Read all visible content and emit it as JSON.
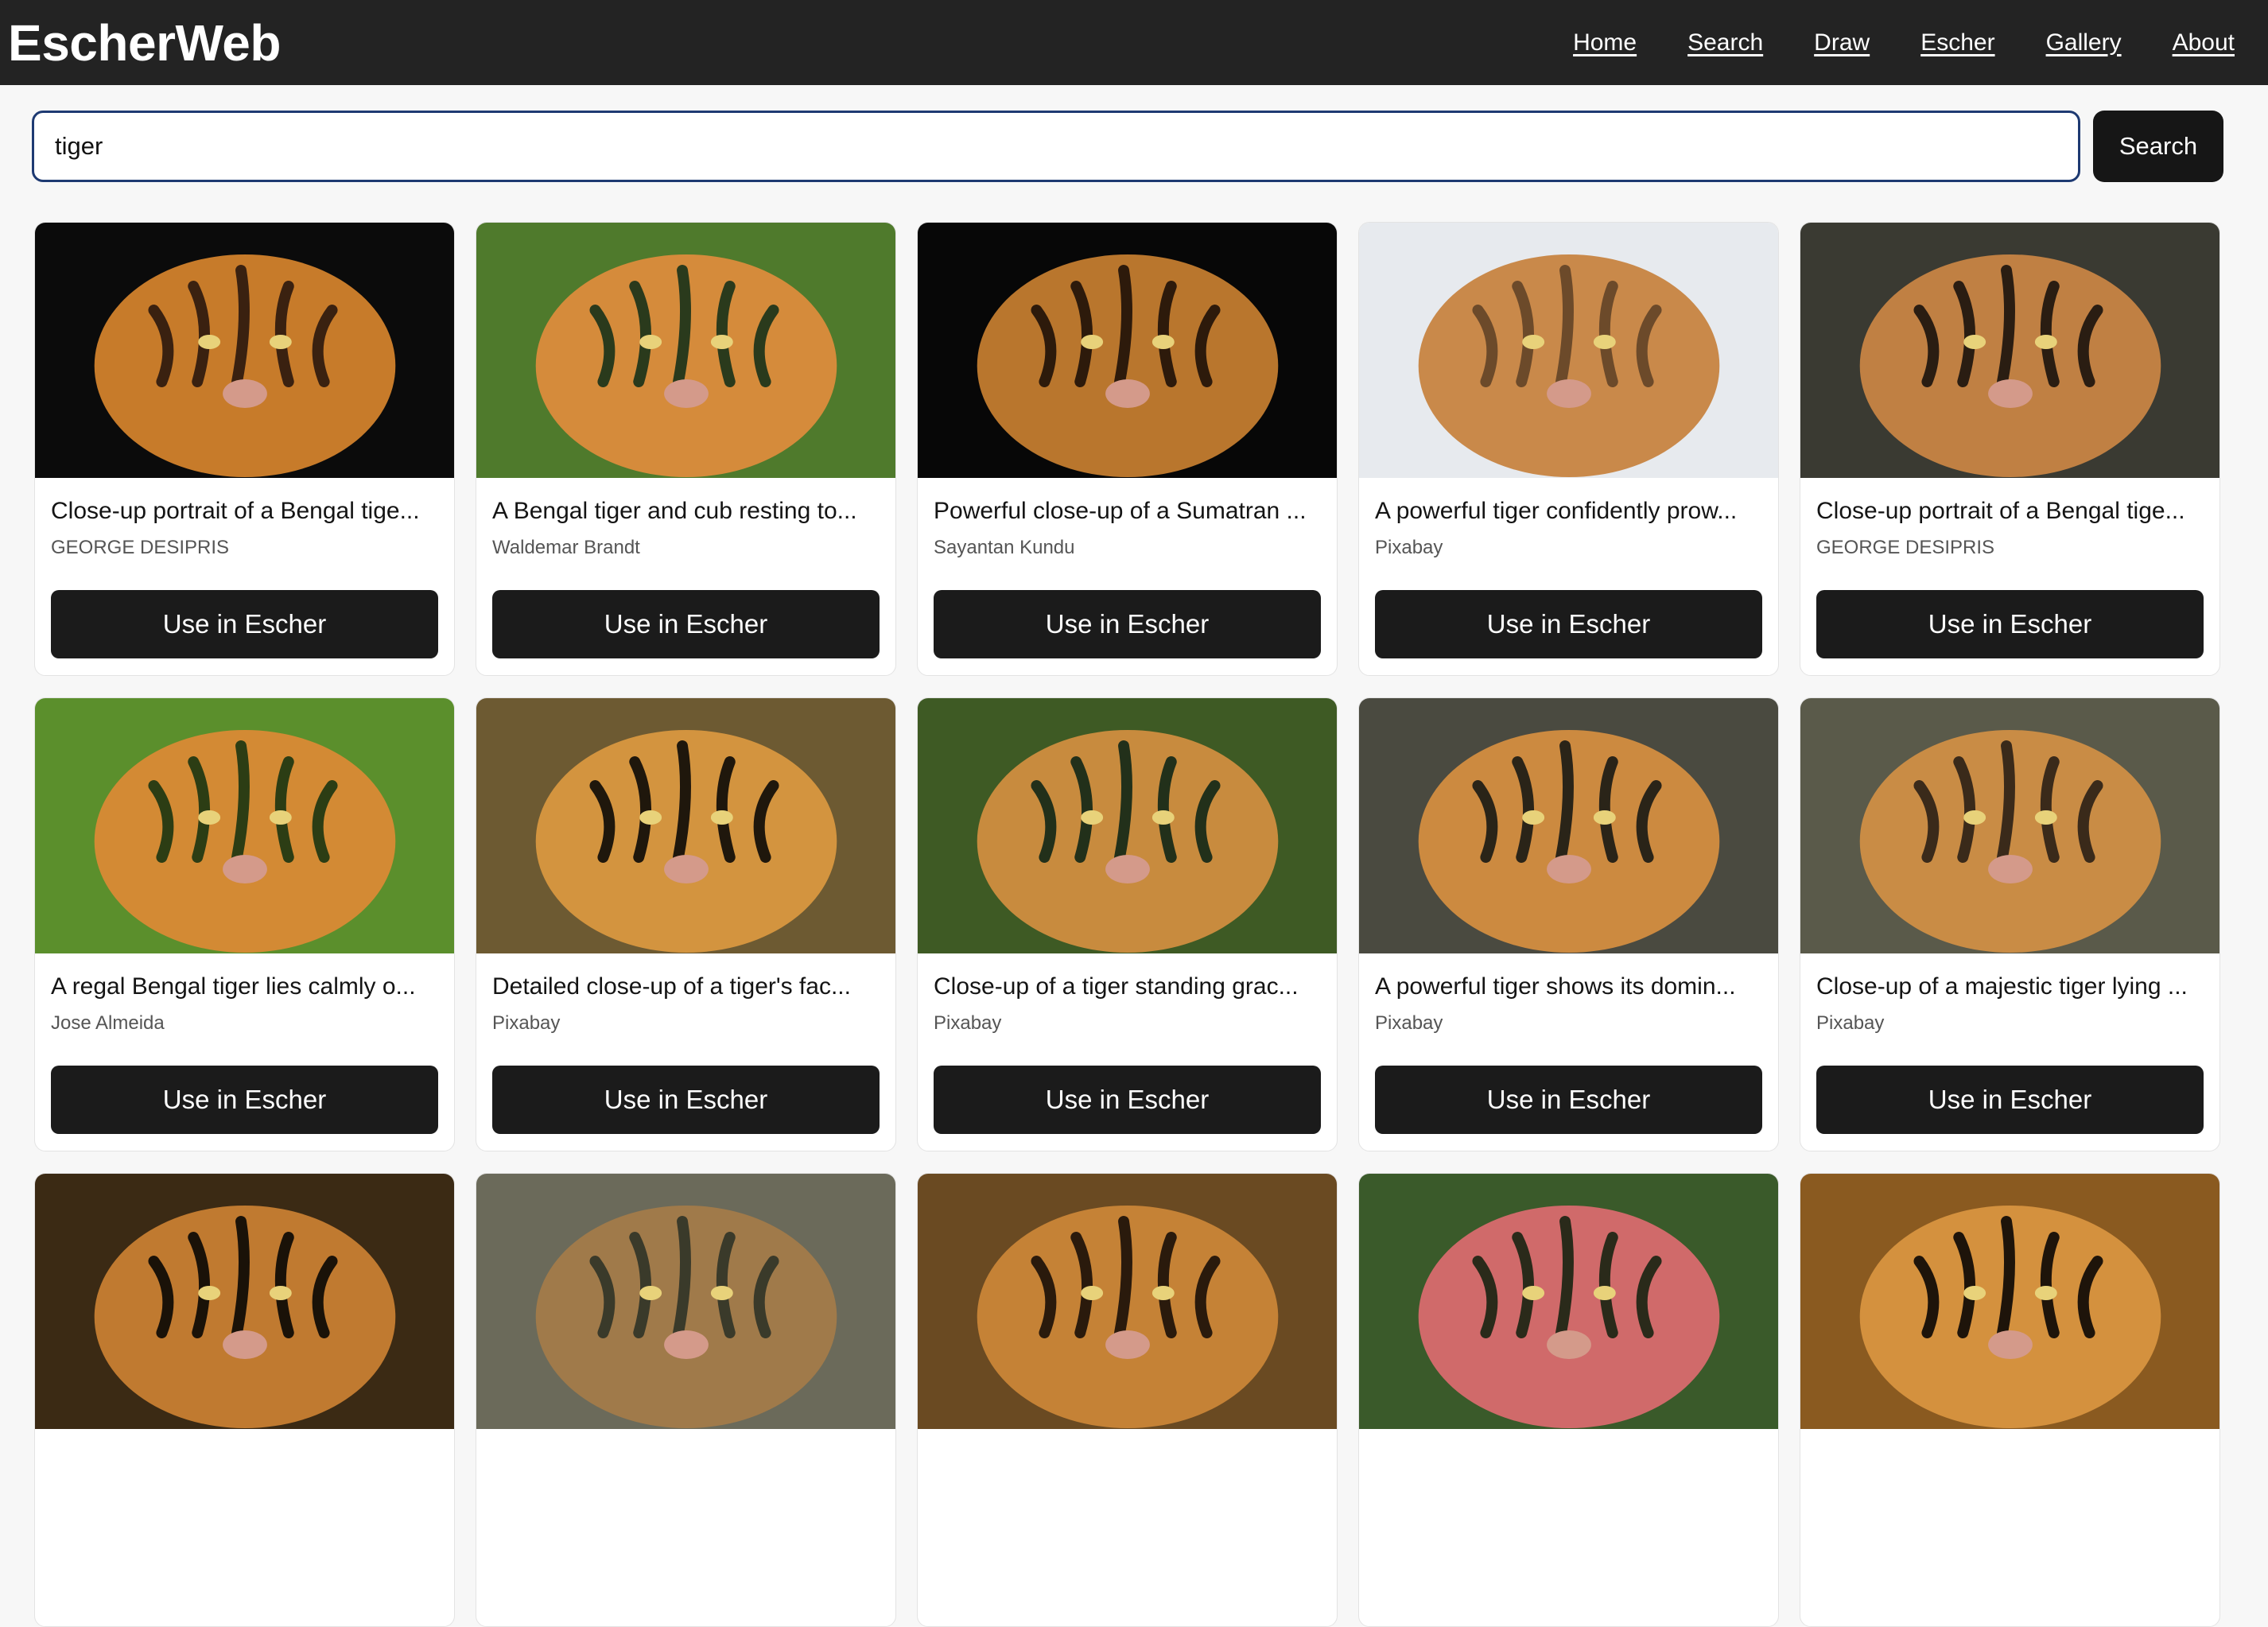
{
  "app": {
    "brand": "EscherWeb"
  },
  "nav": {
    "items": [
      {
        "label": "Home"
      },
      {
        "label": "Search"
      },
      {
        "label": "Draw"
      },
      {
        "label": "Escher"
      },
      {
        "label": "Gallery"
      },
      {
        "label": "About"
      }
    ]
  },
  "search": {
    "value": "tiger",
    "button_label": "Search"
  },
  "results": [
    {
      "title": "Close-up portrait of a Bengal tige...",
      "author": "GEORGE DESIPRIS",
      "button": "Use in Escher",
      "image_colors": [
        "#0b0b0b",
        "#c77b2a",
        "#3a2110"
      ]
    },
    {
      "title": "A Bengal tiger and cub resting to...",
      "author": "Waldemar Brandt",
      "button": "Use in Escher",
      "image_colors": [
        "#4f7a2c",
        "#d58b3b",
        "#2a3a1c"
      ]
    },
    {
      "title": "Powerful close-up of a Sumatran ...",
      "author": "Sayantan Kundu",
      "button": "Use in Escher",
      "image_colors": [
        "#070707",
        "#b9762d",
        "#2d1a0b"
      ]
    },
    {
      "title": "A powerful tiger confidently prow...",
      "author": "Pixabay",
      "button": "Use in Escher",
      "image_colors": [
        "#e7eaee",
        "#c9894a",
        "#6c4a2a"
      ]
    },
    {
      "title": "Close-up portrait of a Bengal tige...",
      "author": "GEORGE DESIPRIS",
      "button": "Use in Escher",
      "image_colors": [
        "#3a3a32",
        "#c08043",
        "#2a1d12"
      ]
    },
    {
      "title": "A regal Bengal tiger lies calmly o...",
      "author": "Jose Almeida",
      "button": "Use in Escher",
      "image_colors": [
        "#5b8f2c",
        "#d38a34",
        "#2c3d14"
      ]
    },
    {
      "title": "Detailed close-up of a tiger's fac...",
      "author": "Pixabay",
      "button": "Use in Escher",
      "image_colors": [
        "#6d5a32",
        "#d3943f",
        "#1f170c"
      ]
    },
    {
      "title": "Close-up of a tiger standing grac...",
      "author": "Pixabay",
      "button": "Use in Escher",
      "image_colors": [
        "#3e5a24",
        "#c88b3e",
        "#22301a"
      ]
    },
    {
      "title": "A powerful tiger shows its domin...",
      "author": "Pixabay",
      "button": "Use in Escher",
      "image_colors": [
        "#4a4a40",
        "#cc8a40",
        "#2a2418"
      ]
    },
    {
      "title": "Close-up of a majestic tiger lying ...",
      "author": "Pixabay",
      "button": "Use in Escher",
      "image_colors": [
        "#5a5a4a",
        "#c98c45",
        "#3a2a1a"
      ]
    },
    {
      "title": "",
      "author": "",
      "button": "",
      "image_colors": [
        "#3b2a14",
        "#c07a30",
        "#1a1208"
      ]
    },
    {
      "title": "",
      "author": "",
      "button": "",
      "image_colors": [
        "#6b6a5a",
        "#a07a4a",
        "#3a3a2a"
      ]
    },
    {
      "title": "",
      "author": "",
      "button": "",
      "image_colors": [
        "#6a4a22",
        "#c58236",
        "#2a1a0c"
      ]
    },
    {
      "title": "",
      "author": "",
      "button": "",
      "image_colors": [
        "#3a5a2a",
        "#d06a6a",
        "#2a2a1a"
      ]
    },
    {
      "title": "",
      "author": "",
      "button": "",
      "image_colors": [
        "#8a5a20",
        "#d4913e",
        "#1e140a"
      ]
    }
  ]
}
